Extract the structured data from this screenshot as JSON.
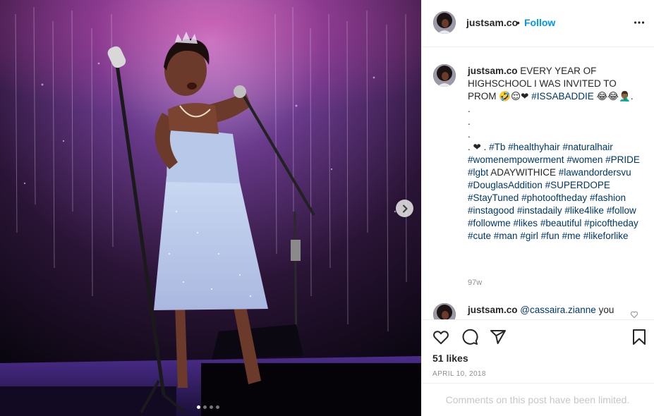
{
  "post": {
    "username": "justsam.co",
    "bullet": "•",
    "follow_label": "Follow",
    "more_icon": "more-options-icon",
    "caption_username": "justsam.co",
    "caption_segments": [
      {
        "t": " EVERY YEAR OF HIGHSCHOOL I WAS INVITED TO PROM 🤣😌❤ ",
        "tag": false
      },
      {
        "t": "#ISSABADDIE",
        "tag": true
      },
      {
        "t": " 😂😂🤦🏾‍♂️.\n.\n.\n.\n. ❤ . ",
        "tag": false
      },
      {
        "t": "#Tb",
        "tag": true
      },
      {
        "t": " ",
        "tag": false
      },
      {
        "t": "#healthyhair",
        "tag": true
      },
      {
        "t": " ",
        "tag": false
      },
      {
        "t": "#naturalhair",
        "tag": true
      },
      {
        "t": " ",
        "tag": false
      },
      {
        "t": "#womenempowerment",
        "tag": true
      },
      {
        "t": " ",
        "tag": false
      },
      {
        "t": "#women",
        "tag": true
      },
      {
        "t": " ",
        "tag": false
      },
      {
        "t": "#PRIDE",
        "tag": true
      },
      {
        "t": " ",
        "tag": false
      },
      {
        "t": "#lgbt",
        "tag": true
      },
      {
        "t": " ADAYWITHICE ",
        "tag": false
      },
      {
        "t": "#lawandordersvu",
        "tag": true
      },
      {
        "t": " ",
        "tag": false
      },
      {
        "t": "#DouglasAddition",
        "tag": true
      },
      {
        "t": " ",
        "tag": false
      },
      {
        "t": "#SUPERDOPE",
        "tag": true
      },
      {
        "t": " ",
        "tag": false
      },
      {
        "t": "#StayTuned",
        "tag": true
      },
      {
        "t": " ",
        "tag": false
      },
      {
        "t": "#photooftheday",
        "tag": true
      },
      {
        "t": " ",
        "tag": false
      },
      {
        "t": "#fashion",
        "tag": true
      },
      {
        "t": " ",
        "tag": false
      },
      {
        "t": "#instagood",
        "tag": true
      },
      {
        "t": " ",
        "tag": false
      },
      {
        "t": "#instadaily",
        "tag": true
      },
      {
        "t": " ",
        "tag": false
      },
      {
        "t": "#like4like",
        "tag": true
      },
      {
        "t": " ",
        "tag": false
      },
      {
        "t": "#follow",
        "tag": true
      },
      {
        "t": " ",
        "tag": false
      },
      {
        "t": "#followme",
        "tag": true
      },
      {
        "t": " ",
        "tag": false
      },
      {
        "t": "#likes",
        "tag": true
      },
      {
        "t": " ",
        "tag": false
      },
      {
        "t": "#beautiful",
        "tag": true
      },
      {
        "t": " ",
        "tag": false
      },
      {
        "t": "#picoftheday",
        "tag": true
      },
      {
        "t": " ",
        "tag": false
      },
      {
        "t": "#cute",
        "tag": true
      },
      {
        "t": " ",
        "tag": false
      },
      {
        "t": "#man",
        "tag": true
      },
      {
        "t": " ",
        "tag": false
      },
      {
        "t": "#girl",
        "tag": true
      },
      {
        "t": " ",
        "tag": false
      },
      {
        "t": "#fun",
        "tag": true
      },
      {
        "t": " ",
        "tag": false
      },
      {
        "t": "#me",
        "tag": true
      },
      {
        "t": " ",
        "tag": false
      },
      {
        "t": "#likeforlike",
        "tag": true
      }
    ],
    "caption_age": "97w",
    "comment": {
      "username": "justsam.co",
      "mention": "@cassaira.zianne",
      "text": " you"
    },
    "likes": "51 likes",
    "date": "APRIL 10, 2018",
    "limited_notice": "Comments on this post have been limited.",
    "carousel": {
      "count": 4,
      "active": 0
    }
  },
  "colors": {
    "link": "#00376b",
    "follow": "#0095f6",
    "muted": "#8e8e8e",
    "text": "#262626"
  },
  "icons": [
    "heart-icon",
    "comment-icon",
    "share-icon",
    "bookmark-icon",
    "next-arrow-icon"
  ]
}
